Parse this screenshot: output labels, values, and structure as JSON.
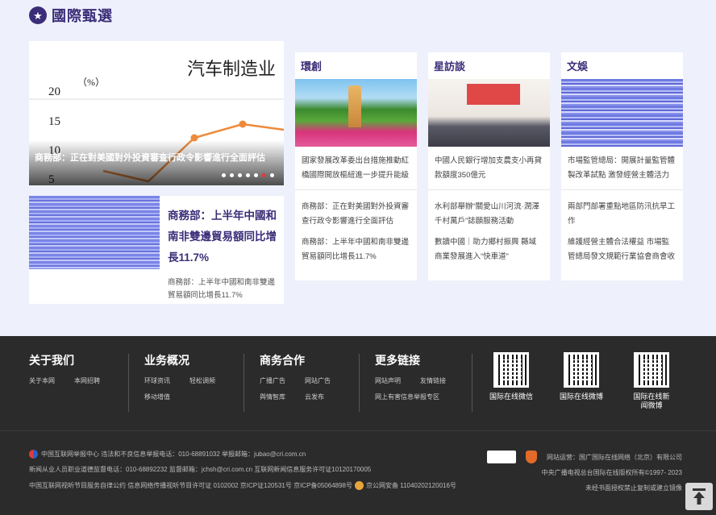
{
  "section": {
    "title": "國際甄選"
  },
  "slider": {
    "caption": "商務部：正在對美國對外投資審查行政令影響進行全面評估",
    "image": {
      "heading": "汽车制造业",
      "unit": "（%）",
      "ticks": [
        "20",
        "15",
        "10",
        "5"
      ]
    },
    "dots": 7,
    "active_dot": 5
  },
  "feature": {
    "title": "商務部：上半年中國和南非雙邊貿易額同比增長11.7%",
    "subtitle": "商務部：上半年中國和南非雙邊貿易額同比增長11.7%"
  },
  "cards": [
    {
      "heading": "環創",
      "lead": "國家發展改革委出台措施推動紅橋國際開放樞紐進一步提升能級",
      "second": "商務部：正在對美國對外投資審查行政令影響進行全面評估",
      "third": "商務部：上半年中國和南非雙邊貿易額同比增長11.7%"
    },
    {
      "heading": "星訪談",
      "lead": "中國人民銀行增加支農支小再貸款額度350億元",
      "second": "水利部舉辦“關愛山川河流·潤澤千村萬戶”誌願服務活動",
      "third": "數讀中國｜助力鄉村振興 縣域商業發展進入“快車道”"
    },
    {
      "heading": "文娛",
      "lead": "市場監管總局：開展計量監管體製改革試點 激發經營主體活力",
      "second": "兩部門部署重點地區防汛抗旱工作",
      "third": "維護經營主體合法權益 市場監管總局發文規範行業協會商會收"
    }
  ],
  "footer": {
    "cols": [
      {
        "title": "关于我们",
        "links": [
          "关于本网",
          "本网招聘"
        ]
      },
      {
        "title": "业务概况",
        "links": [
          "环球资讯",
          "轻松调频",
          "移动增值"
        ]
      },
      {
        "title": "商务合作",
        "links": [
          "广播广告",
          "网站广告",
          "舆情智库",
          "云发布"
        ]
      },
      {
        "title": "更多链接",
        "links": [
          "网站声明",
          "友情链接",
          "网上有害信息举报专区"
        ]
      }
    ],
    "qr": [
      {
        "label": "国际在线微信"
      },
      {
        "label": "国际在线微博"
      },
      {
        "label": "国际在线新闻微博"
      }
    ],
    "bottom": {
      "line1": "中国互联网举报中心 违法和不良信息举报电话：010-68891032 举报邮箱：jubao@cri.com.cn",
      "line2": "新闻从业人员职业道德监督电话：010-68892232 监督邮箱：jchsh@cri.com.cn 互联网新闻信息服务许可证10120170005",
      "line3a": "中国互联网视听节目服务自律公约 信息网络传播视听节目许可证 0102002  京ICP证120531号  京ICP备05064898号",
      "line3b": "京公网安备 11040202120016号",
      "right1": "网站运营：国广国际在线网络（北京）有限公司",
      "right2": "中央广播电视总台国际在线版权所有©1997- 2023",
      "right3": "未经书面授权禁止复制或建立镜像"
    }
  }
}
